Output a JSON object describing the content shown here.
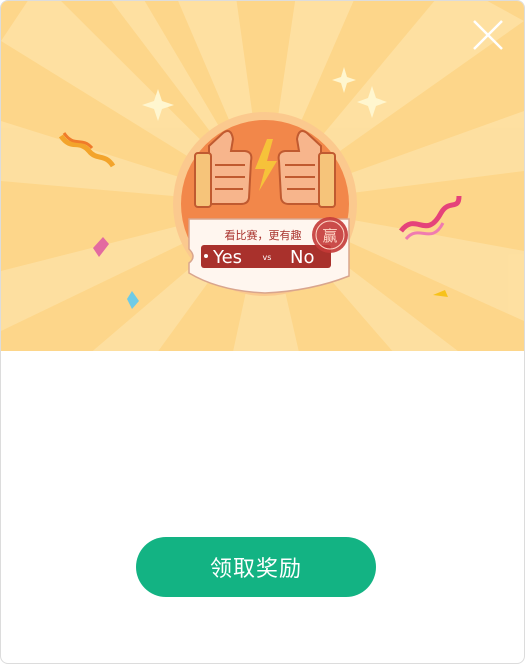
{
  "colors": {
    "banner_bg": "#fdd68a",
    "circle_fill": "#f2874a",
    "ticket_red": "#a9312c",
    "button_bg": "#13b383",
    "button_text": "#ffffff"
  },
  "banner": {
    "illustration": "thumbs-up-match-ticket",
    "ticket": {
      "tagline": "看比赛，更有趣",
      "left_label": "Yes",
      "vs_label": "vs",
      "right_label": "No",
      "stamp_label": "赢"
    }
  },
  "close": {
    "icon": "close-icon"
  },
  "action": {
    "claim_label": "领取奖励"
  }
}
